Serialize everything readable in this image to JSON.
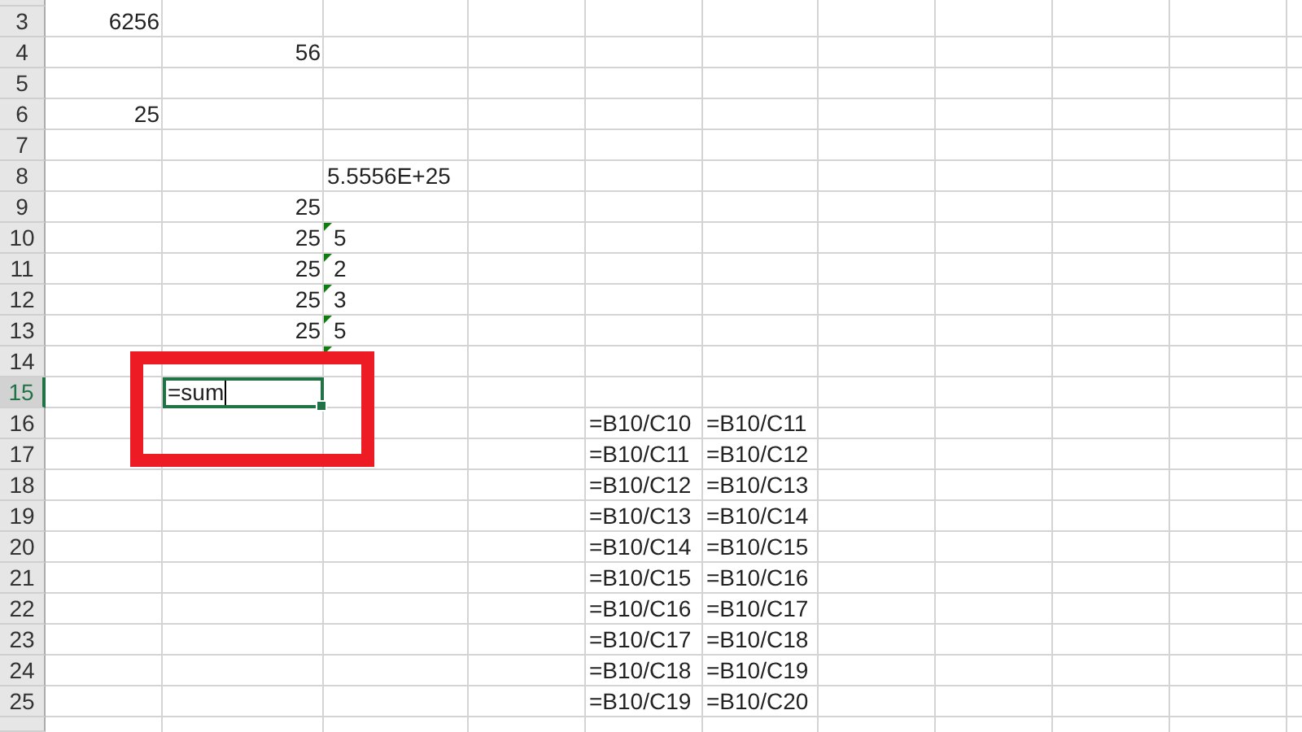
{
  "sheet": {
    "rows": [
      {
        "label": "3",
        "selected": false,
        "column_1": {
          "text": "6256",
          "kind": "number",
          "selected": false
        }
      },
      {
        "label": "4",
        "selected": false,
        "column_2": {
          "text": "56",
          "kind": "number",
          "selected": false
        }
      },
      {
        "label": "5",
        "selected": false
      },
      {
        "label": "6",
        "selected": false,
        "column_1": {
          "text": "25",
          "kind": "number",
          "selected": false
        }
      },
      {
        "label": "7",
        "selected": false
      },
      {
        "label": "8",
        "selected": false,
        "column_3": {
          "text": "5.5556E+25",
          "kind": "text",
          "selected": false
        }
      },
      {
        "label": "9",
        "selected": false,
        "column_2": {
          "text": "25",
          "kind": "number",
          "selected": false
        }
      },
      {
        "label": "10",
        "selected": false,
        "column_2": {
          "text": "25",
          "kind": "number",
          "selected": false
        },
        "column_3": {
          "text": "5",
          "kind": "text",
          "warning": true,
          "selected": false
        }
      },
      {
        "label": "11",
        "selected": false,
        "column_2": {
          "text": "25",
          "kind": "number",
          "selected": false
        },
        "column_3": {
          "text": "2",
          "kind": "text",
          "warning": true,
          "selected": false
        }
      },
      {
        "label": "12",
        "selected": false,
        "column_2": {
          "text": "25",
          "kind": "number",
          "selected": false
        },
        "column_3": {
          "text": "3",
          "kind": "text",
          "warning": true,
          "selected": false
        }
      },
      {
        "label": "13",
        "selected": false,
        "column_2": {
          "text": "25",
          "kind": "number",
          "selected": false
        },
        "column_3": {
          "text": "5",
          "kind": "text",
          "warning": true,
          "selected": false
        }
      },
      {
        "label": "14",
        "selected": false,
        "column_3": {
          "kind": "text",
          "warning": true,
          "selected": false
        }
      },
      {
        "label": "15",
        "selected": true,
        "column_2": {
          "text": "=sum",
          "kind": "text",
          "selected": true
        }
      },
      {
        "label": "16",
        "selected": false,
        "column_5": {
          "text": "=B10/C10",
          "kind": "text",
          "selected": false
        },
        "column_6": {
          "text": "=B10/C11",
          "kind": "text",
          "selected": false
        }
      },
      {
        "label": "17",
        "selected": false,
        "column_5": {
          "text": "=B10/C11",
          "kind": "text",
          "selected": false
        },
        "column_6": {
          "text": "=B10/C12",
          "kind": "text",
          "selected": false
        }
      },
      {
        "label": "18",
        "selected": false,
        "column_5": {
          "text": "=B10/C12",
          "kind": "text",
          "selected": false
        },
        "column_6": {
          "text": "=B10/C13",
          "kind": "text",
          "selected": false
        }
      },
      {
        "label": "19",
        "selected": false,
        "column_5": {
          "text": "=B10/C13",
          "kind": "text",
          "selected": false
        },
        "column_6": {
          "text": "=B10/C14",
          "kind": "text",
          "selected": false
        }
      },
      {
        "label": "20",
        "selected": false,
        "column_5": {
          "text": "=B10/C14",
          "kind": "text",
          "selected": false
        },
        "column_6": {
          "text": "=B10/C15",
          "kind": "text",
          "selected": false
        }
      },
      {
        "label": "21",
        "selected": false,
        "column_5": {
          "text": "=B10/C15",
          "kind": "text",
          "selected": false
        },
        "column_6": {
          "text": "=B10/C16",
          "kind": "text",
          "selected": false
        }
      },
      {
        "label": "22",
        "selected": false,
        "column_5": {
          "text": "=B10/C16",
          "kind": "text",
          "selected": false
        },
        "column_6": {
          "text": "=B10/C17",
          "kind": "text",
          "selected": false
        }
      },
      {
        "label": "23",
        "selected": false,
        "column_5": {
          "text": "=B10/C17",
          "kind": "text",
          "selected": false
        },
        "column_6": {
          "text": "=B10/C18",
          "kind": "text",
          "selected": false
        }
      },
      {
        "label": "24",
        "selected": false,
        "column_5": {
          "text": "=B10/C18",
          "kind": "text",
          "selected": false
        },
        "column_6": {
          "text": "=B10/C19",
          "kind": "text",
          "selected": false
        }
      },
      {
        "label": "25",
        "selected": false,
        "column_5": {
          "text": "=B10/C19",
          "kind": "text",
          "selected": false
        },
        "column_6": {
          "text": "=B10/C20",
          "kind": "text",
          "selected": false
        }
      }
    ]
  },
  "highlight": true
}
